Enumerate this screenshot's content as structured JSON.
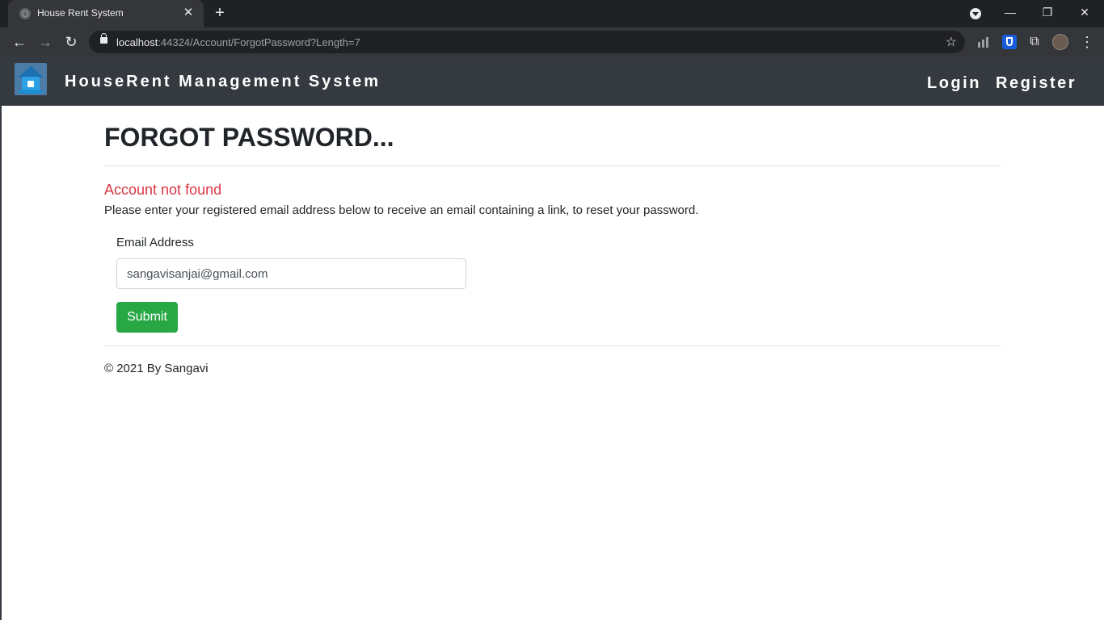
{
  "browser": {
    "tab_title": "House Rent System",
    "tab_close": "✕",
    "new_tab": "+",
    "url_host": "localhost",
    "url_rest": ":44324/Account/ForgotPassword?Length=7",
    "icons": {
      "back": "←",
      "forward": "→",
      "reload": "↻",
      "star": "☆",
      "puzzle": "⧉",
      "menu": "⋮",
      "minimize": "—",
      "restore": "❐",
      "close": "✕"
    }
  },
  "navbar": {
    "brand": "HouseRent Management System",
    "login": "Login",
    "register": "Register"
  },
  "page": {
    "title": "FORGOT PASSWORD...",
    "error": "Account not found",
    "instructions": "Please enter your registered email address below to receive an email containing a link, to reset your password.",
    "email_label": "Email Address",
    "email_value": "sangavisanjai@gmail.com",
    "submit": "Submit",
    "footer": "© 2021 By Sangavi"
  },
  "colors": {
    "navbar_bg": "#343a40",
    "error": "#dc3545",
    "submit_bg": "#28a745"
  }
}
